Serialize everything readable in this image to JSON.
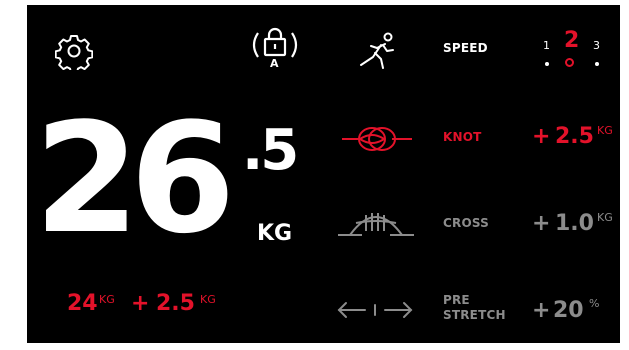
{
  "weight": {
    "integer": "26",
    "decimal": ".5",
    "unit": "KG"
  },
  "base_weight": {
    "value": "24",
    "unit": "KG",
    "plus": "+",
    "added": "2.5",
    "added_unit": "KG"
  },
  "speed": {
    "label": "SPEED",
    "options": [
      "1",
      "2",
      "3"
    ],
    "selected": "2"
  },
  "modes": [
    {
      "label": "KNOT",
      "sign": "+",
      "value": "2.5",
      "unit": "KG",
      "active": true,
      "icon": "knot-icon"
    },
    {
      "label": "CROSS",
      "sign": "+",
      "value": "1.0",
      "unit": "KG",
      "active": false,
      "icon": "cross-icon"
    },
    {
      "label_line1": "PRE",
      "label_line2": "STRETCH",
      "sign": "+",
      "value": "20",
      "unit": "%",
      "active": false,
      "icon": "stretch-arrows-icon"
    }
  ],
  "lock": {
    "letter": "A",
    "icon": "auto-lock-icon"
  },
  "icons": {
    "settings": "gear-icon",
    "sprint": "runner-icon"
  },
  "colors": {
    "background": "#000000",
    "accent": "#e3122a",
    "inactive": "#8c8c8c",
    "text": "#ffffff"
  }
}
